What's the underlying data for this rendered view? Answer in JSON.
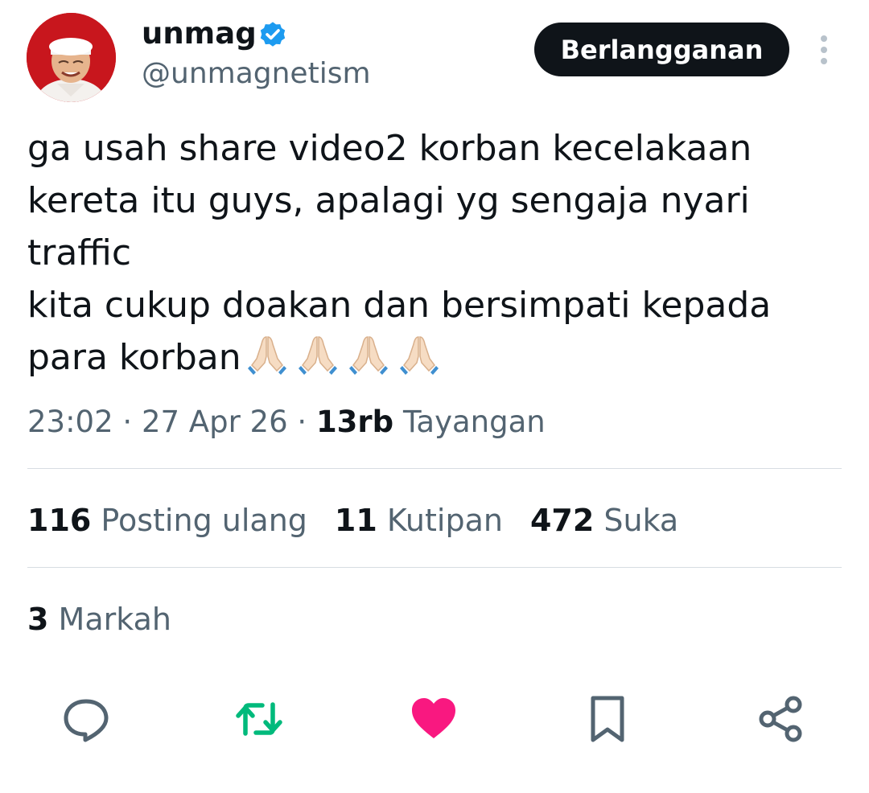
{
  "author": {
    "display_name": "unmag",
    "handle": "@unmagnetism",
    "verified": true
  },
  "subscribe_button": {
    "label": "Berlangganan"
  },
  "tweet": {
    "lines": [
      "ga usah share video2 korban kecelakaan",
      "kereta itu guys, apalagi yg sengaja nyari",
      "traffic",
      "kita cukup doakan dan bersimpati kepada",
      "para korban"
    ],
    "emoji": [
      "🙏🏻",
      "🙏🏻",
      "🙏🏻",
      "🙏🏻"
    ]
  },
  "meta": {
    "time": "23:02",
    "separator": "·",
    "date": "27 Apr 26",
    "views_count": "13rb",
    "views_label": "Tayangan"
  },
  "stats": [
    {
      "count": "116",
      "label": "Posting ulang"
    },
    {
      "count": "11",
      "label": "Kutipan"
    },
    {
      "count": "472",
      "label": "Suka"
    }
  ],
  "bookmarks": {
    "count": "3",
    "label": "Markah"
  },
  "actions": {
    "reply": "reply-icon",
    "retweet": "retweet-icon",
    "like": "heart-icon",
    "bookmark": "bookmark-icon",
    "share": "share-icon"
  },
  "colors": {
    "text_primary": "#0f1419",
    "text_secondary": "#536471",
    "verified_blue": "#1d9bf0",
    "retweet_green": "#00ba7c",
    "like_pink": "#f91880",
    "divider": "#d7dde2"
  }
}
